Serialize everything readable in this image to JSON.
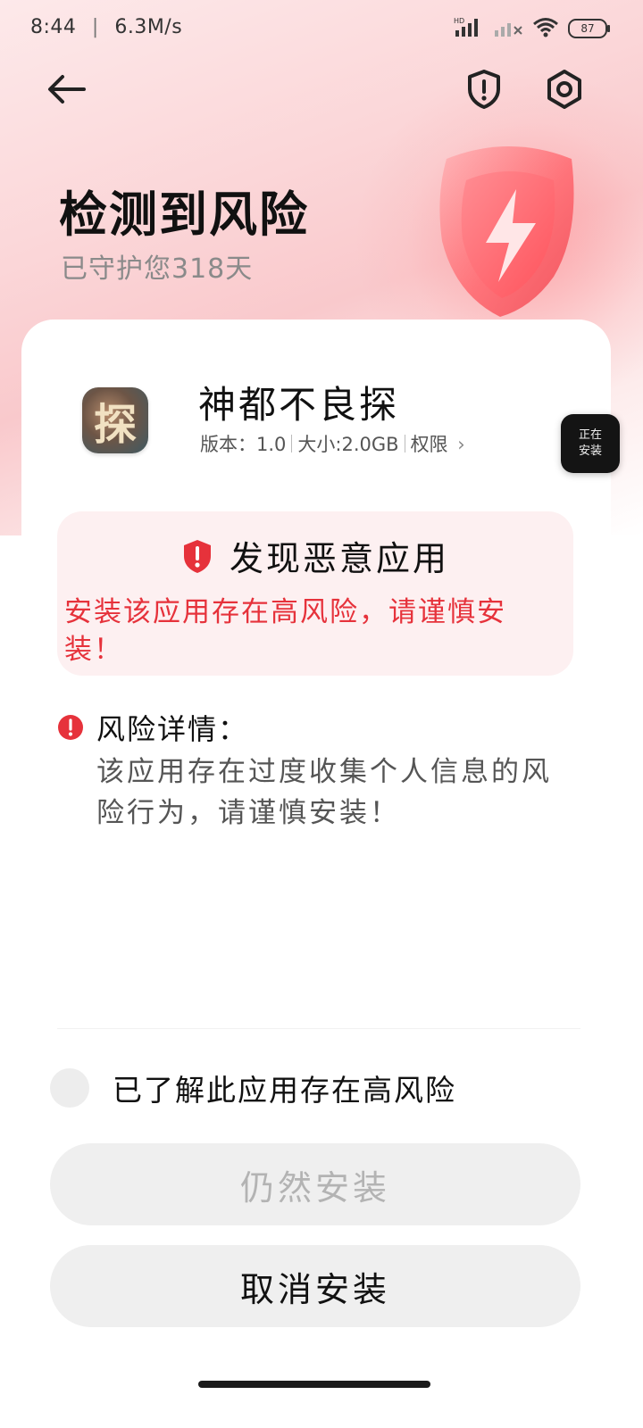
{
  "status_bar": {
    "time": "8:44",
    "separator": "|",
    "speed": "6.3M/s",
    "hd_label": "HD",
    "battery": "87"
  },
  "nav": {
    "back_icon": "arrow-left-icon",
    "report_icon": "shield-alert-icon",
    "settings_icon": "gear-icon"
  },
  "hero": {
    "title": "检测到风险",
    "subtitle": "已守护您318天",
    "accent_color": "#ff5a62"
  },
  "app": {
    "icon_glyph": "探",
    "name": "神都不良探",
    "version": "版本：1.0",
    "size": "大小:2.0GB",
    "permissions": "权限",
    "chevron": "›"
  },
  "floating_badge": {
    "line1": "正在",
    "line2": "安装"
  },
  "alert": {
    "title": "发现恶意应用",
    "text": "安装该应用存在高风险，请谨慎安装！",
    "text_color": "#e6323b"
  },
  "risk": {
    "label": "风险详情：",
    "text": "该应用存在过度收集个人信息的风险行为，请谨慎安装！"
  },
  "acknowledge": {
    "label": "已了解此应用存在高风险",
    "checked": false
  },
  "buttons": {
    "install_anyway": "仍然安装",
    "cancel_install": "取消安装"
  }
}
